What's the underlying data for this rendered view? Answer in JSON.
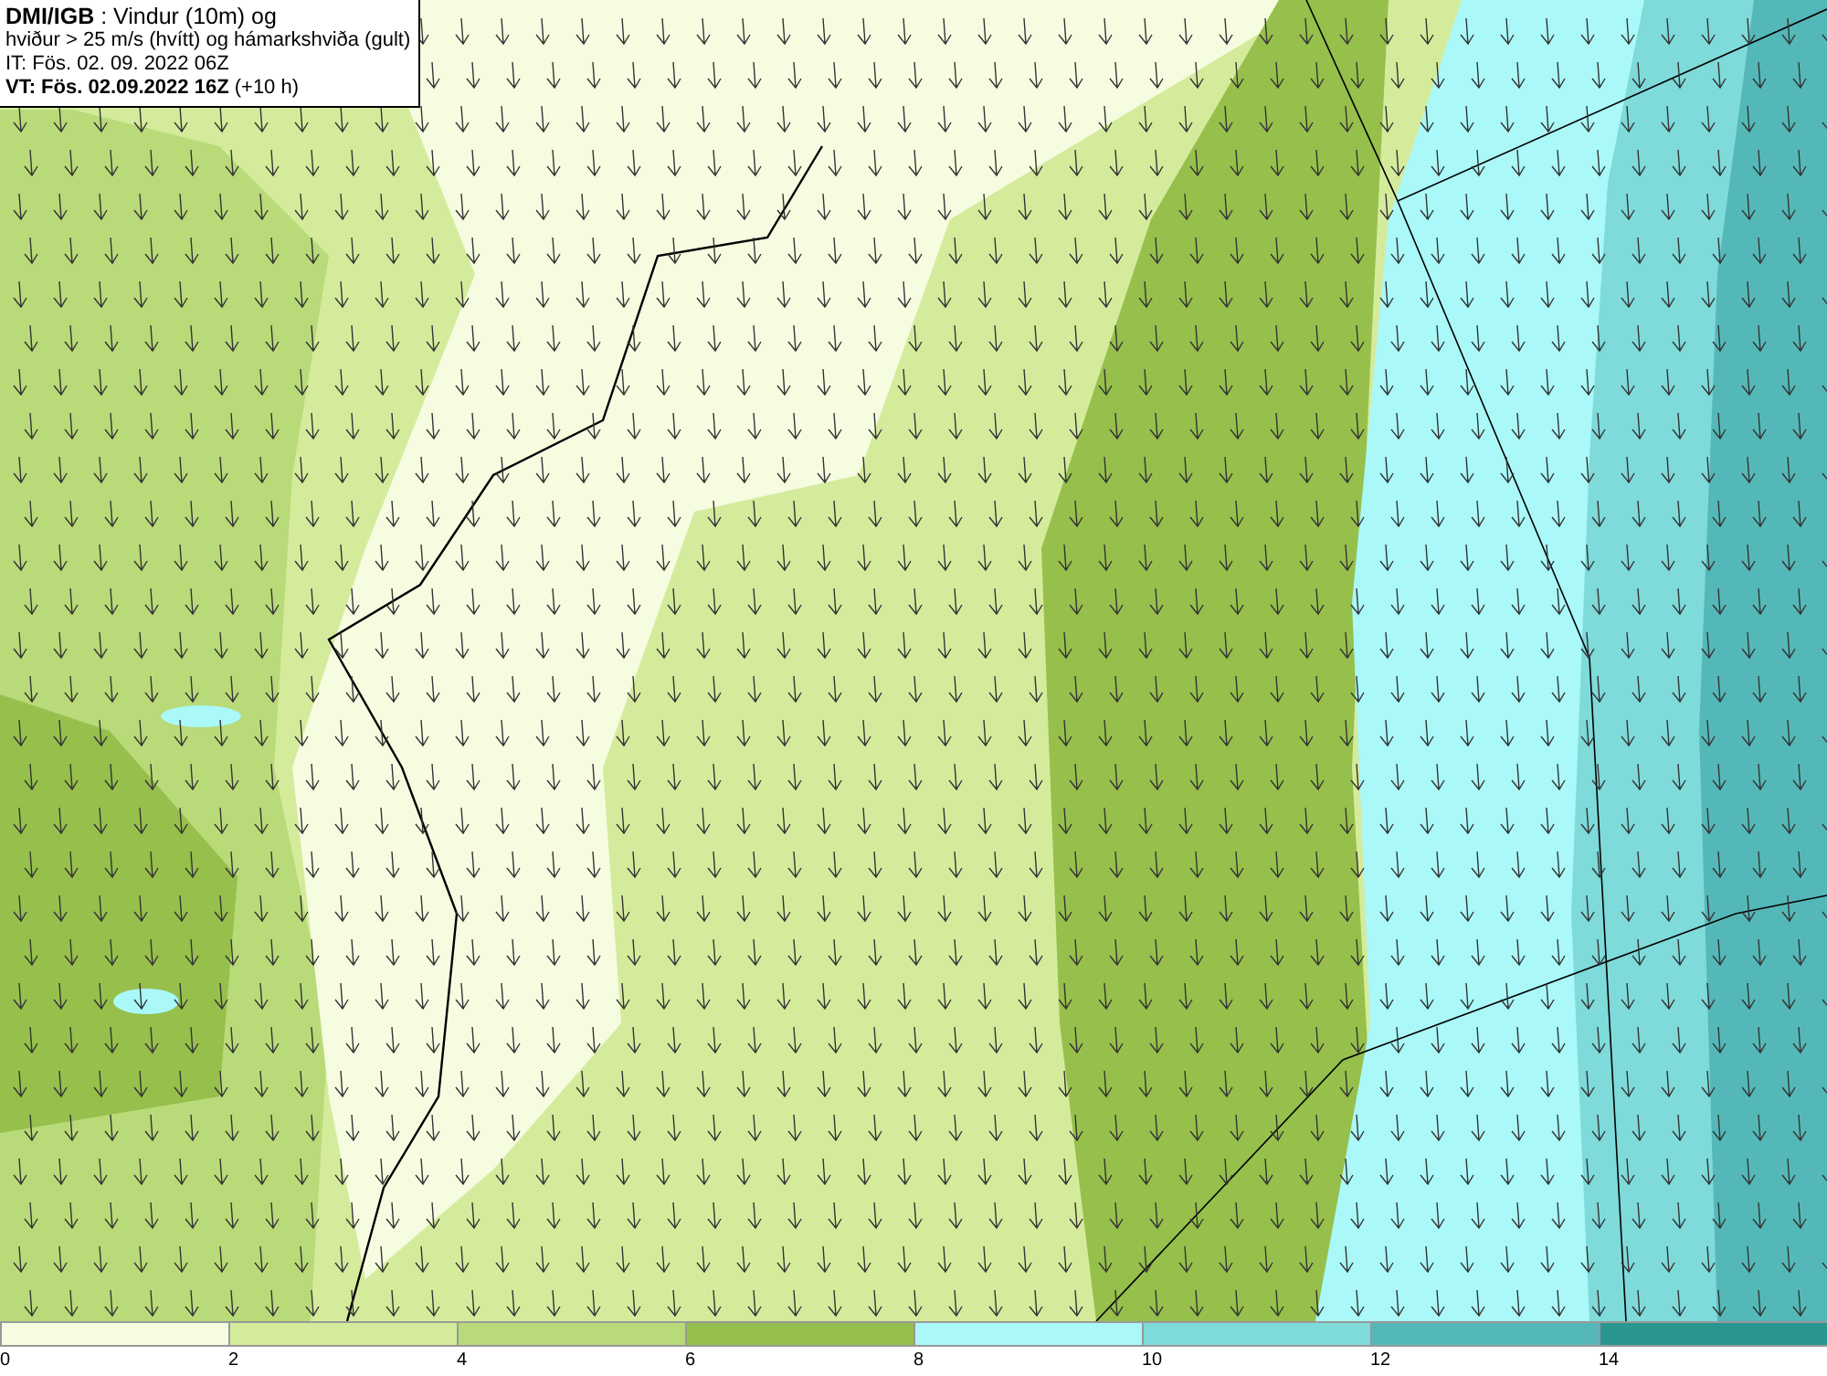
{
  "title_box": {
    "lines": [
      "**DMI/IGB** : Vindur (10m) og",
      "hviður > 25 m/s (hvítt) og hámarkshviða (gult)",
      "IT: Fös. 02. 09. 2022 06Z",
      "**VT: Fös. 02.09.2022 16Z** (+10 h)"
    ]
  },
  "legend": {
    "bins": [
      {
        "label": "0",
        "color": "#f5fce0"
      },
      {
        "label": "2",
        "color": "#d5eb9c"
      },
      {
        "label": "4",
        "color": "#b9da78"
      },
      {
        "label": "6",
        "color": "#96bf4c"
      },
      {
        "label": "8",
        "color": "#aaf8f8"
      },
      {
        "label": "10",
        "color": "#7fdada"
      },
      {
        "label": "12",
        "color": "#55b8b8"
      },
      {
        "label": "14",
        "color": "#2a9690"
      }
    ]
  }
}
